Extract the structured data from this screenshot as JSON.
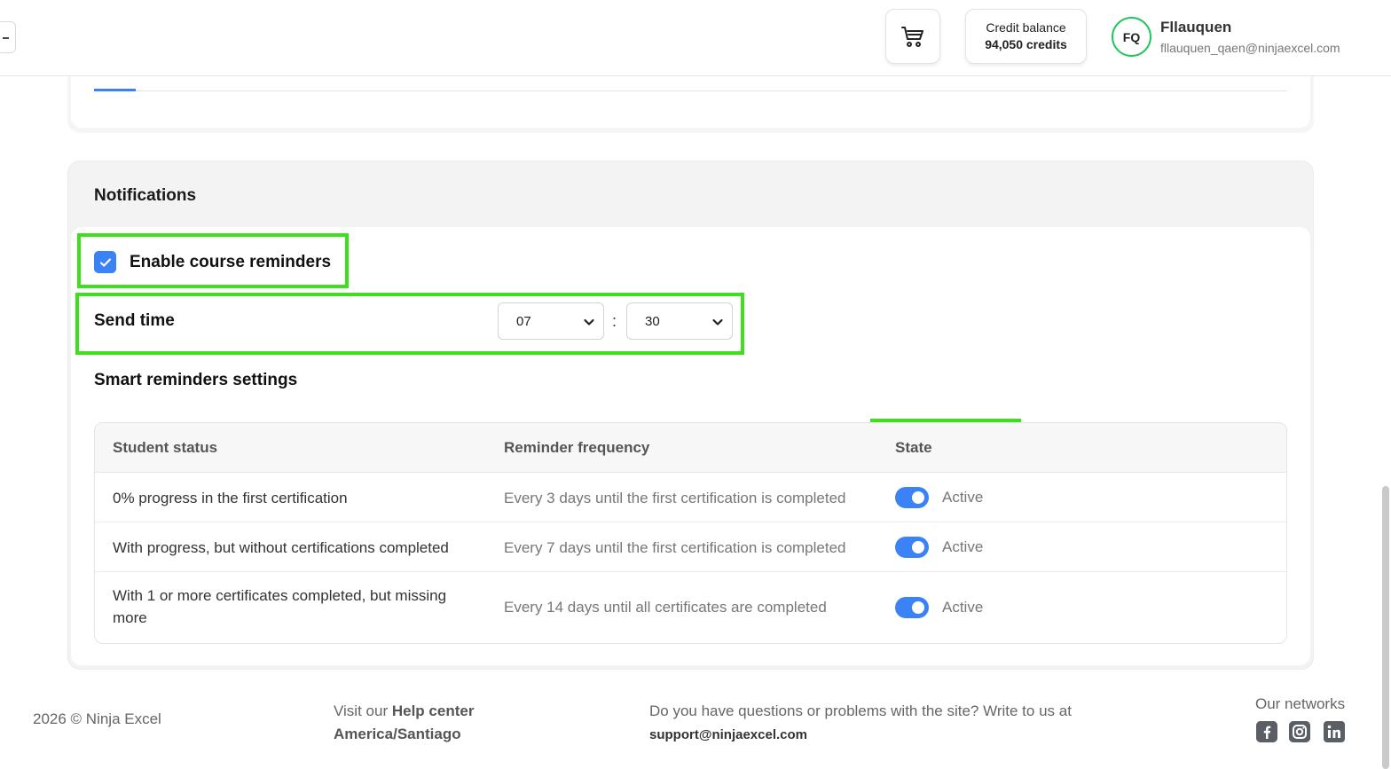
{
  "header": {
    "credit_label": "Credit balance",
    "credit_value": "94,050 credits",
    "avatar_initials": "FQ",
    "user_name": "Fllauquen",
    "user_email": "fllauquen_qaen@ninjaexcel.com",
    "cart_icon": "cart-icon"
  },
  "notifications": {
    "title": "Notifications",
    "enable_label": "Enable course reminders",
    "enable_checked": true,
    "send_time_label": "Send time",
    "hour_value": "07",
    "minute_value": "30",
    "separator": ":",
    "smart_title": "Smart reminders settings",
    "table": {
      "headers": [
        "Student status",
        "Reminder frequency",
        "State"
      ],
      "rows": [
        {
          "status": "0% progress in the first certification",
          "frequency": "Every 3 days until the first certification is completed",
          "state": "Active"
        },
        {
          "status": "With progress, but without certifications completed",
          "frequency": "Every 7 days until the first certification is completed",
          "state": "Active"
        },
        {
          "status": "With 1 or more certificates completed, but missing more",
          "frequency": "Every 14 days until all certificates are completed",
          "state": "Active"
        }
      ]
    }
  },
  "footer": {
    "copyright": "2026 © Ninja Excel",
    "help_prefix": "Visit our",
    "help_link": "Help center",
    "timezone": "America/Santiago",
    "question": "Do you have questions or problems with the site? Write to us at",
    "support_email": "support@ninjaexcel.com",
    "networks_label": "Our networks"
  },
  "colors": {
    "accent": "#3b82f6",
    "highlight": "#3ee01e",
    "avatar_ring": "#22c55e"
  }
}
